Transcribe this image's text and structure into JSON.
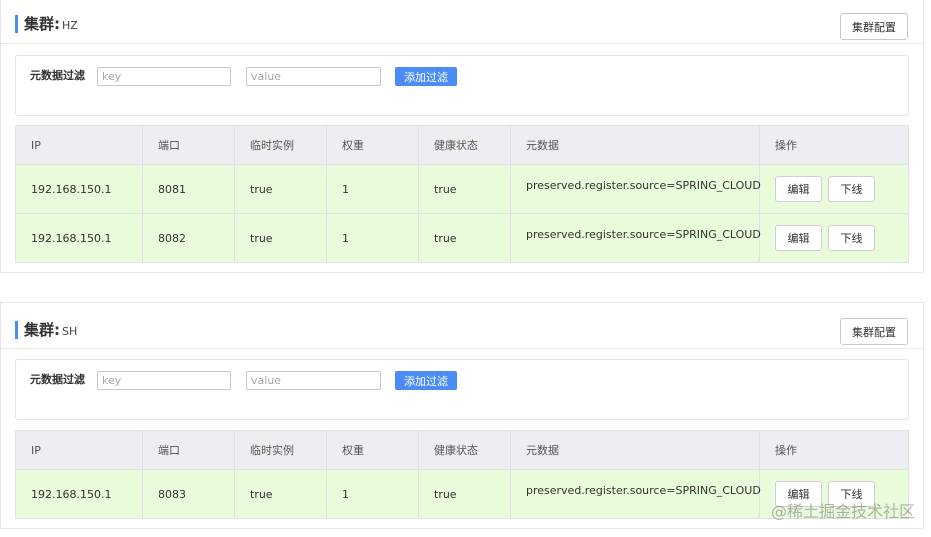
{
  "columns": [
    "IP",
    "端口",
    "临时实例",
    "权重",
    "健康状态",
    "元数据",
    "操作"
  ],
  "filter": {
    "label": "元数据过滤",
    "key_placeholder": "key",
    "value_placeholder": "value",
    "add_label": "添加过滤"
  },
  "row_buttons": {
    "edit": "编辑",
    "offline": "下线"
  },
  "clusters": [
    {
      "label": "集群:",
      "name": "HZ",
      "config_label": "集群配置",
      "rows": [
        {
          "ip": "192.168.150.1",
          "port": "8081",
          "ephemeral": "true",
          "weight": "1",
          "healthy": "true",
          "metadata": "preserved.register.source=SPRING_CLOUD"
        },
        {
          "ip": "192.168.150.1",
          "port": "8082",
          "ephemeral": "true",
          "weight": "1",
          "healthy": "true",
          "metadata": "preserved.register.source=SPRING_CLOUD"
        }
      ]
    },
    {
      "label": "集群:",
      "name": "SH",
      "config_label": "集群配置",
      "rows": [
        {
          "ip": "192.168.150.1",
          "port": "8083",
          "ephemeral": "true",
          "weight": "1",
          "healthy": "true",
          "metadata": "preserved.register.source=SPRING_CLOUD"
        }
      ]
    }
  ],
  "watermark": "@稀土掘金技术社区",
  "colors": {
    "accent": "#4b8cf5",
    "row_background": "#e8fbdb",
    "header_background": "#edeef2"
  }
}
